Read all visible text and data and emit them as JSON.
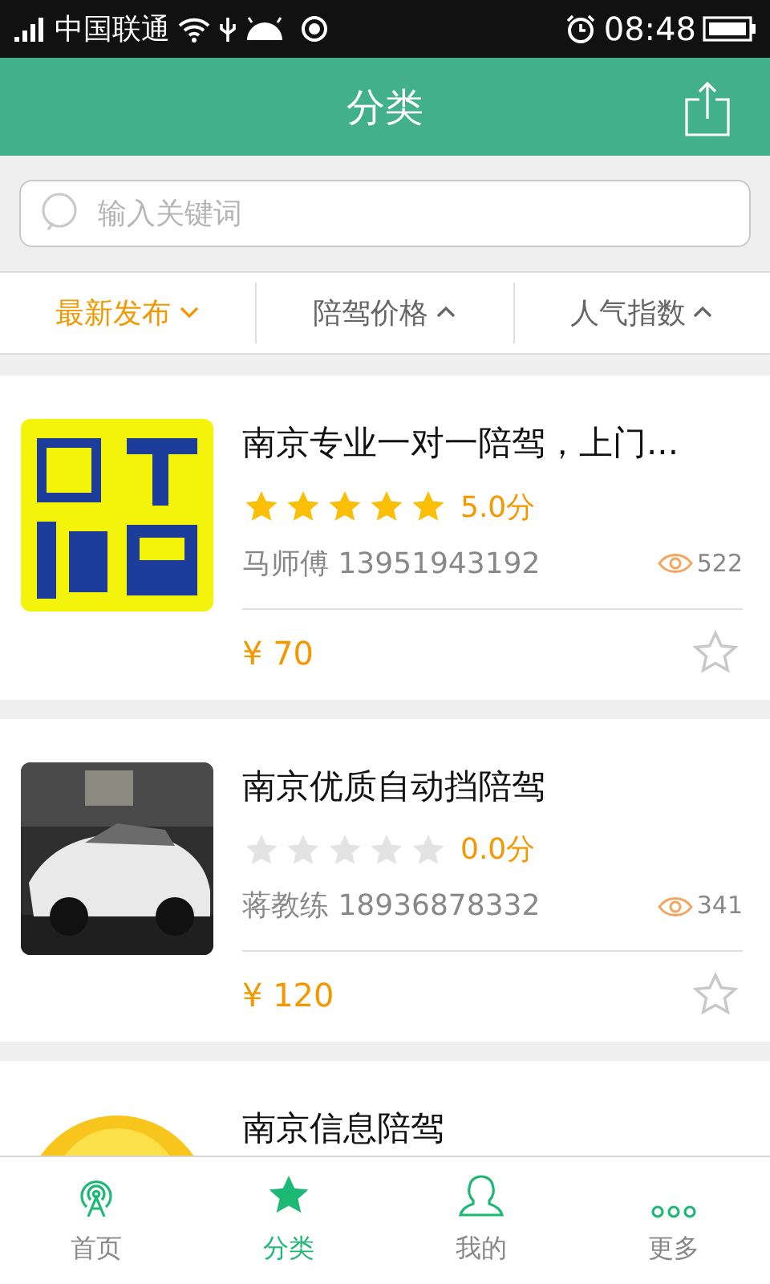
{
  "status_bar": {
    "carrier": "中国联通",
    "time": "08:48"
  },
  "header": {
    "title": "分类"
  },
  "search": {
    "placeholder": "输入关键词"
  },
  "sort_options": [
    {
      "label": "最新发布",
      "selected": true,
      "kind": "down"
    },
    {
      "label": "陪驾价格",
      "selected": false,
      "kind": "up"
    },
    {
      "label": "人气指数",
      "selected": false,
      "kind": "up"
    }
  ],
  "listings": [
    {
      "title": "南京专业一对一陪驾，上门...",
      "stars": 5,
      "score": "5.0分",
      "contact": "马师傅 13951943192",
      "views": "522",
      "price": "¥ 70",
      "favorited": false
    },
    {
      "title": "南京优质自动挡陪驾",
      "stars": 0,
      "score": "0.0分",
      "contact": "蒋教练 18936878332",
      "views": "341",
      "price": "¥ 120",
      "favorited": false
    },
    {
      "title": "南京信息陪驾"
    }
  ],
  "tab_bar": [
    {
      "kind": "home",
      "label": "首页",
      "selected": false
    },
    {
      "kind": "category",
      "label": "分类",
      "selected": true
    },
    {
      "kind": "profile",
      "label": "我的",
      "selected": false
    },
    {
      "kind": "more",
      "label": "更多",
      "selected": false
    }
  ]
}
